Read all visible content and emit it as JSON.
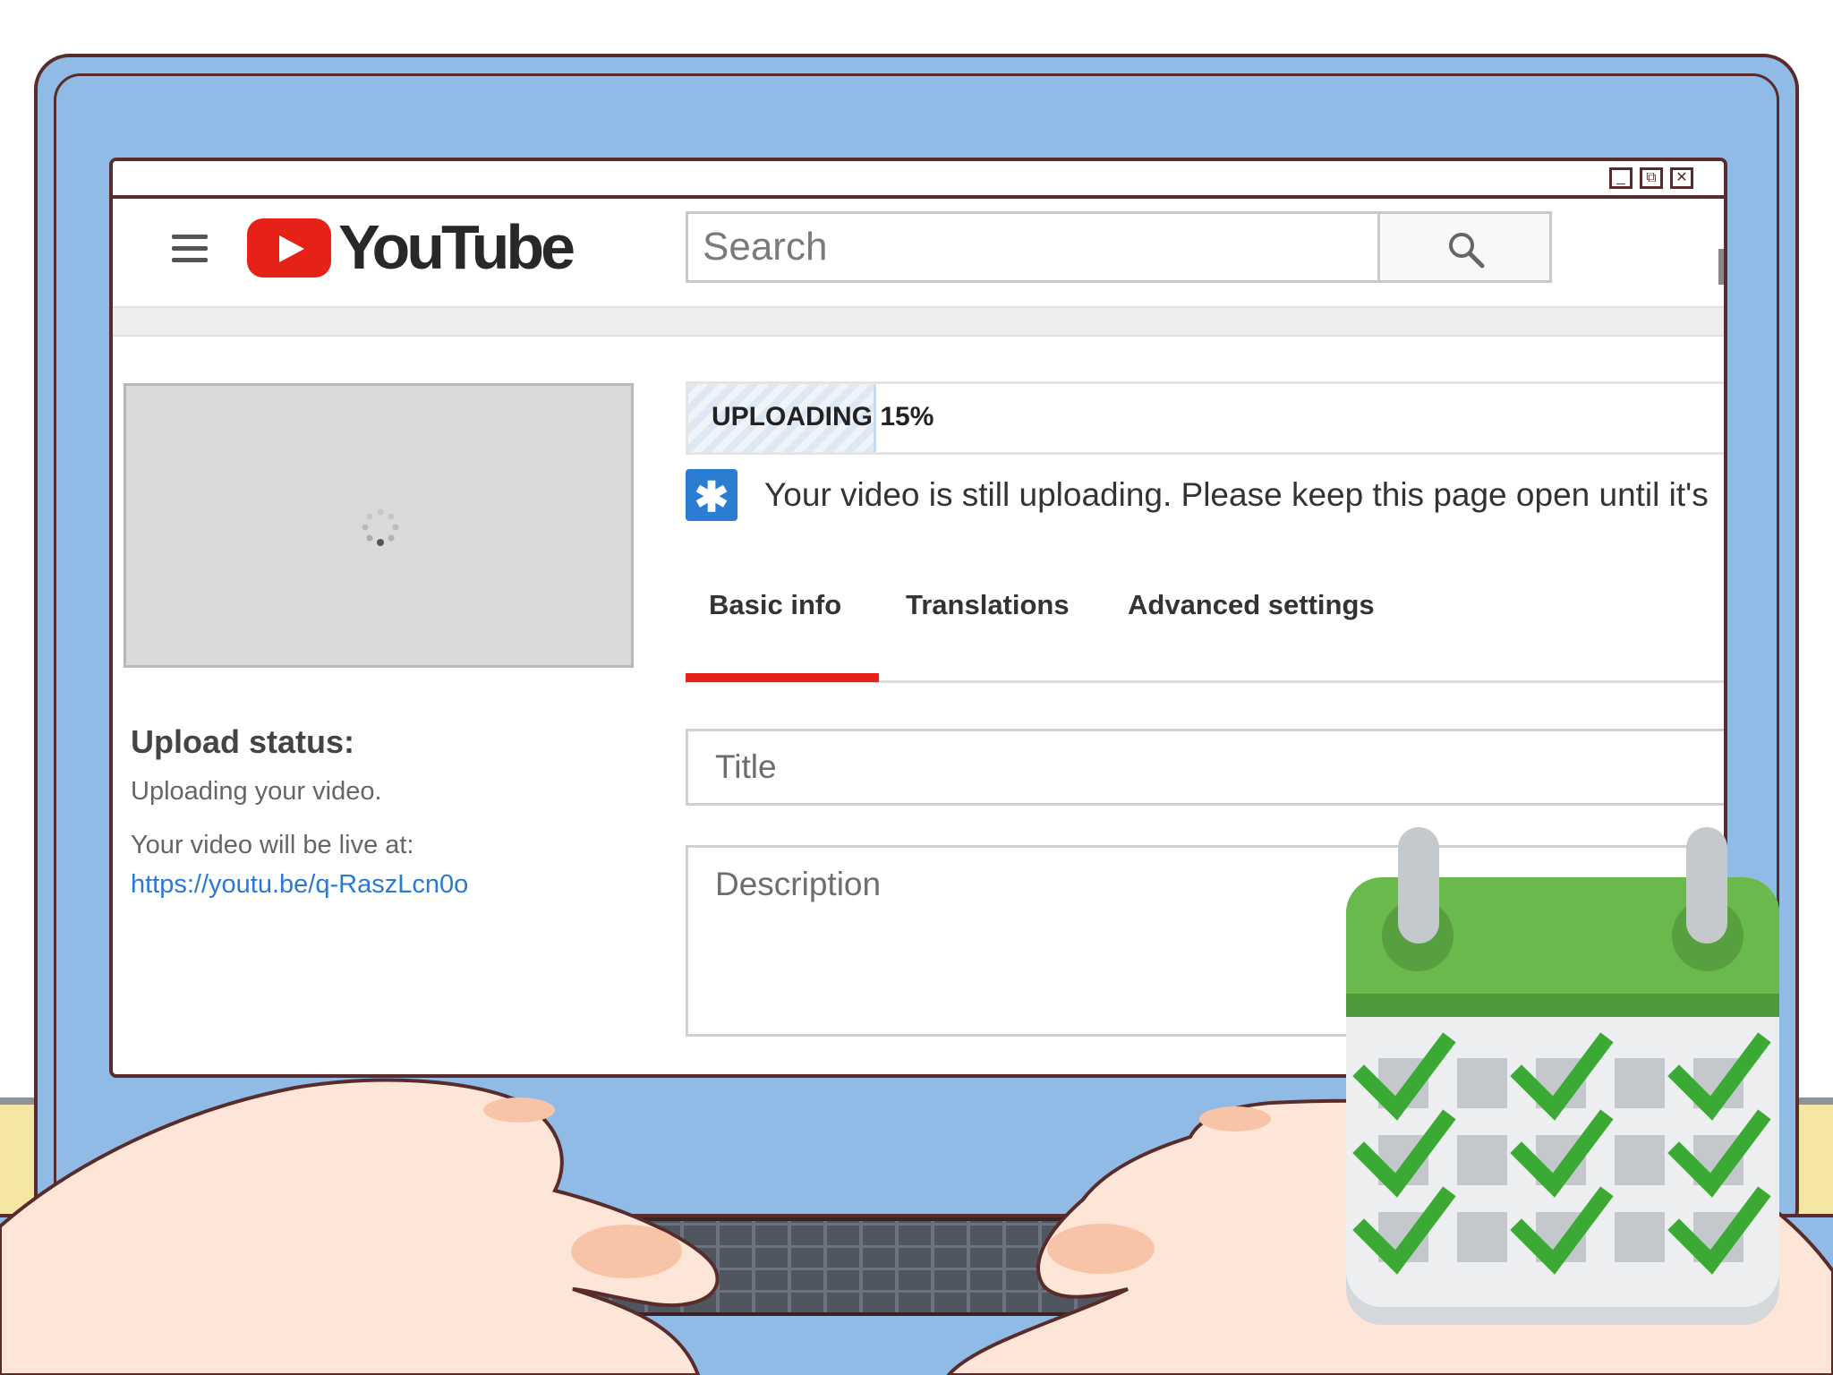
{
  "window_controls": {
    "minimize": "_",
    "restore": "⧉",
    "close": "✕"
  },
  "header": {
    "logo_text": "YouTube",
    "search_placeholder": "Search"
  },
  "upload": {
    "progress_label": "UPLOADING 15%",
    "progress_fraction": 0.15,
    "notice_icon": "✱",
    "notice_text": "Your video is still uploading. Please keep this page open until it's"
  },
  "tabs": [
    {
      "label": "Basic info",
      "active": true
    },
    {
      "label": "Translations",
      "active": false
    },
    {
      "label": "Advanced settings",
      "active": false
    }
  ],
  "form": {
    "title_placeholder": "Title",
    "description_placeholder": "Description"
  },
  "sidebar": {
    "status_label": "Upload status:",
    "status_text": "Uploading your video.",
    "live_label": "Your video will be live at:",
    "live_url": "https://youtu.be/q-RaszLcn0o"
  },
  "colors": {
    "brand_red": "#e62117",
    "link_blue": "#2a7ad2",
    "calendar_green": "#6ab94c",
    "check_green": "#3aaa35"
  },
  "icons": {
    "menu": "hamburger-menu-icon",
    "search": "magnifier-icon",
    "notice": "star-notice-icon",
    "spinner": "loading-spinner-icon",
    "calendar": "calendar-checklist-icon"
  }
}
